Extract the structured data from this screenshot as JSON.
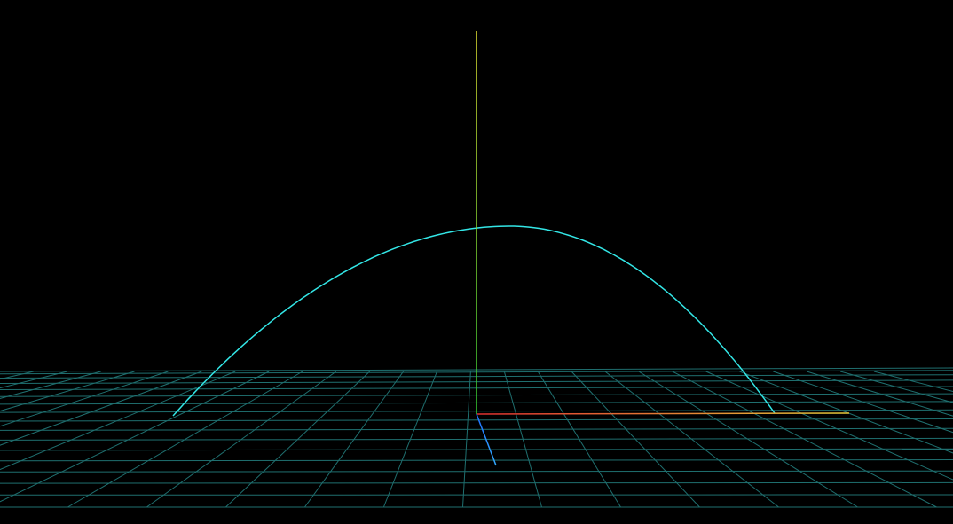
{
  "scene": {
    "background_color": "#000000",
    "grid": {
      "visible": true,
      "color": "#1f6f6f"
    },
    "trajectory": {
      "visible": true,
      "color": "#33e6e6",
      "shape": "parabola"
    },
    "axes": {
      "x": {
        "colors": [
          "#e03030",
          "#e6c83a"
        ]
      },
      "y": {
        "colors": [
          "#33cc33",
          "#e6e633"
        ]
      },
      "z": {
        "colors": [
          "#1e6fff",
          "#33aaff"
        ]
      }
    }
  }
}
